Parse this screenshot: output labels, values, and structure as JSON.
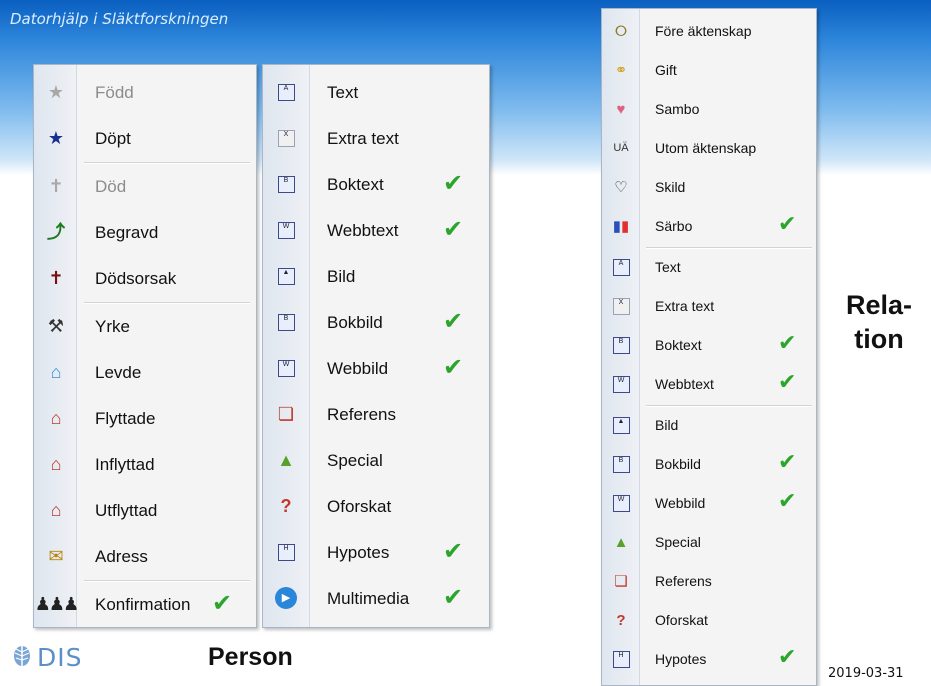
{
  "slide": {
    "title": "Datorhjälp i Släktforskningen",
    "person_caption": "Person",
    "relation_caption": "Rela-\ntion",
    "date": "2019-03-31",
    "logo_text": "DIS"
  },
  "person_events": [
    {
      "label": "Född",
      "icon": "star-gray-icon",
      "disabled": true,
      "checked": false
    },
    {
      "label": "Döpt",
      "icon": "star-blue-icon",
      "disabled": false,
      "checked": false
    },
    {
      "label": "Död",
      "icon": "cross-gray-icon",
      "disabled": true,
      "checked": false
    },
    {
      "label": "Begravd",
      "icon": "shovel-icon",
      "disabled": false,
      "checked": false
    },
    {
      "label": "Dödsorsak",
      "icon": "cross-question-icon",
      "disabled": false,
      "checked": false
    },
    {
      "label": "Yrke",
      "icon": "hammer-icon",
      "disabled": false,
      "checked": false
    },
    {
      "label": "Levde",
      "icon": "house-globe-icon",
      "disabled": false,
      "checked": false
    },
    {
      "label": "Flyttade",
      "icon": "house-move-icon",
      "disabled": false,
      "checked": false
    },
    {
      "label": "Inflyttad",
      "icon": "house-in-icon",
      "disabled": false,
      "checked": false
    },
    {
      "label": "Utflyttad",
      "icon": "house-out-icon",
      "disabled": false,
      "checked": false
    },
    {
      "label": "Adress",
      "icon": "envelope-icon",
      "disabled": false,
      "checked": false
    },
    {
      "label": "Konfirmation",
      "icon": "people-group-icon",
      "disabled": false,
      "checked": true
    }
  ],
  "person_sources": [
    {
      "label": "Text",
      "icon": "text-doc-icon",
      "checked": false
    },
    {
      "label": "Extra text",
      "icon": "extra-text-doc-icon",
      "checked": false
    },
    {
      "label": "Boktext",
      "icon": "book-text-icon",
      "checked": true
    },
    {
      "label": "Webbtext",
      "icon": "web-text-icon",
      "checked": true
    },
    {
      "label": "Bild",
      "icon": "picture-icon",
      "checked": false
    },
    {
      "label": "Bokbild",
      "icon": "book-picture-icon",
      "checked": true
    },
    {
      "label": "Webbild",
      "icon": "web-picture-icon",
      "checked": true
    },
    {
      "label": "Referens",
      "icon": "reference-icon",
      "checked": false
    },
    {
      "label": "Special",
      "icon": "warning-triangle-icon",
      "checked": false
    },
    {
      "label": "Oforskat",
      "icon": "unresearched-icon",
      "checked": false
    },
    {
      "label": "Hypotes",
      "icon": "hypothesis-icon",
      "checked": true
    },
    {
      "label": "Multimedia",
      "icon": "play-circle-icon",
      "checked": true
    }
  ],
  "relation_items": [
    {
      "label": "Före äktenskap",
      "icon": "ring-icon",
      "checked": false
    },
    {
      "label": "Gift",
      "icon": "rings-icon",
      "checked": false
    },
    {
      "label": "Sambo",
      "icon": "hearts-icon",
      "checked": false
    },
    {
      "label": "Utom äktenskap",
      "icon": "ua-icon",
      "icon_text": "UÄ",
      "checked": false
    },
    {
      "label": "Skild",
      "icon": "broken-heart-icon",
      "checked": false
    },
    {
      "label": "Särbo",
      "icon": "couple-icon",
      "checked": true
    },
    {
      "label": "Text",
      "icon": "text-doc-icon",
      "checked": false
    },
    {
      "label": "Extra text",
      "icon": "extra-text-doc-icon",
      "checked": false
    },
    {
      "label": "Boktext",
      "icon": "book-text-icon",
      "checked": true
    },
    {
      "label": "Webbtext",
      "icon": "web-text-icon",
      "checked": true
    },
    {
      "label": "Bild",
      "icon": "picture-icon",
      "checked": false
    },
    {
      "label": "Bokbild",
      "icon": "book-picture-icon",
      "checked": true
    },
    {
      "label": "Webbild",
      "icon": "web-picture-icon",
      "checked": true
    },
    {
      "label": "Special",
      "icon": "warning-triangle-icon",
      "checked": false
    },
    {
      "label": "Referens",
      "icon": "reference-icon",
      "checked": false
    },
    {
      "label": "Oforskat",
      "icon": "unresearched-icon",
      "checked": false
    },
    {
      "label": "Hypotes",
      "icon": "hypothesis-icon",
      "checked": true
    }
  ],
  "check_glyph": "✔",
  "colors": {
    "header_blue": "#0a5fc0",
    "check_green": "#2ba52b",
    "menu_bg": "#f4f4f4",
    "logo_blue": "#5b8fc7"
  }
}
